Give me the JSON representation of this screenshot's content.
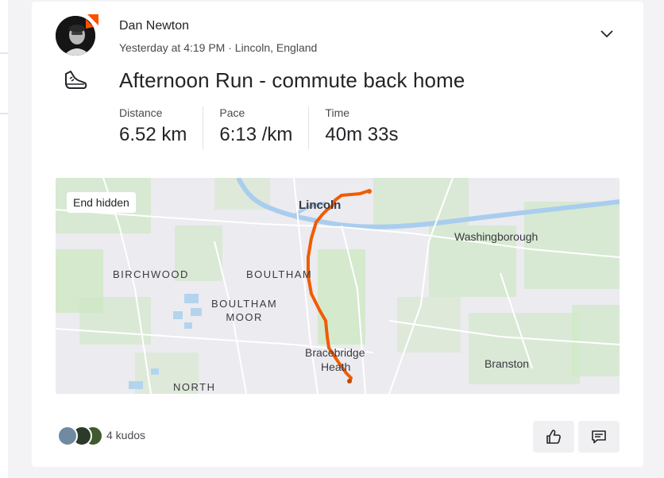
{
  "athlete": {
    "name": "Dan Newton",
    "meta": "Yesterday at 4:19 PM · Lincoln, England"
  },
  "activity": {
    "title": "Afternoon Run - commute back home",
    "sport_icon": "running-shoe-icon",
    "stats": [
      {
        "label": "Distance",
        "value": "6.52 km"
      },
      {
        "label": "Pace",
        "value": "6:13 /km"
      },
      {
        "label": "Time",
        "value": "40m 33s"
      }
    ]
  },
  "map": {
    "end_hidden_label": "End hidden",
    "route_color": "#f05c00",
    "places": {
      "lincoln": "Lincoln",
      "washingborough": "Washingborough",
      "birchwood": "BIRCHWOOD",
      "boultham": "BOULTHAM",
      "boultham_moor": "BOULTHAM\nMOOR",
      "bracebridge": "Bracebridge",
      "heath": "Heath",
      "branston": "Branston",
      "north": "NORTH"
    }
  },
  "kudos": {
    "count_label": "4 kudos"
  },
  "actions": {
    "kudos_icon": "thumbs-up-icon",
    "comment_icon": "comment-icon"
  },
  "colors": {
    "brand": "#fc5200",
    "background": "#f3f3f5",
    "card": "#ffffff"
  }
}
